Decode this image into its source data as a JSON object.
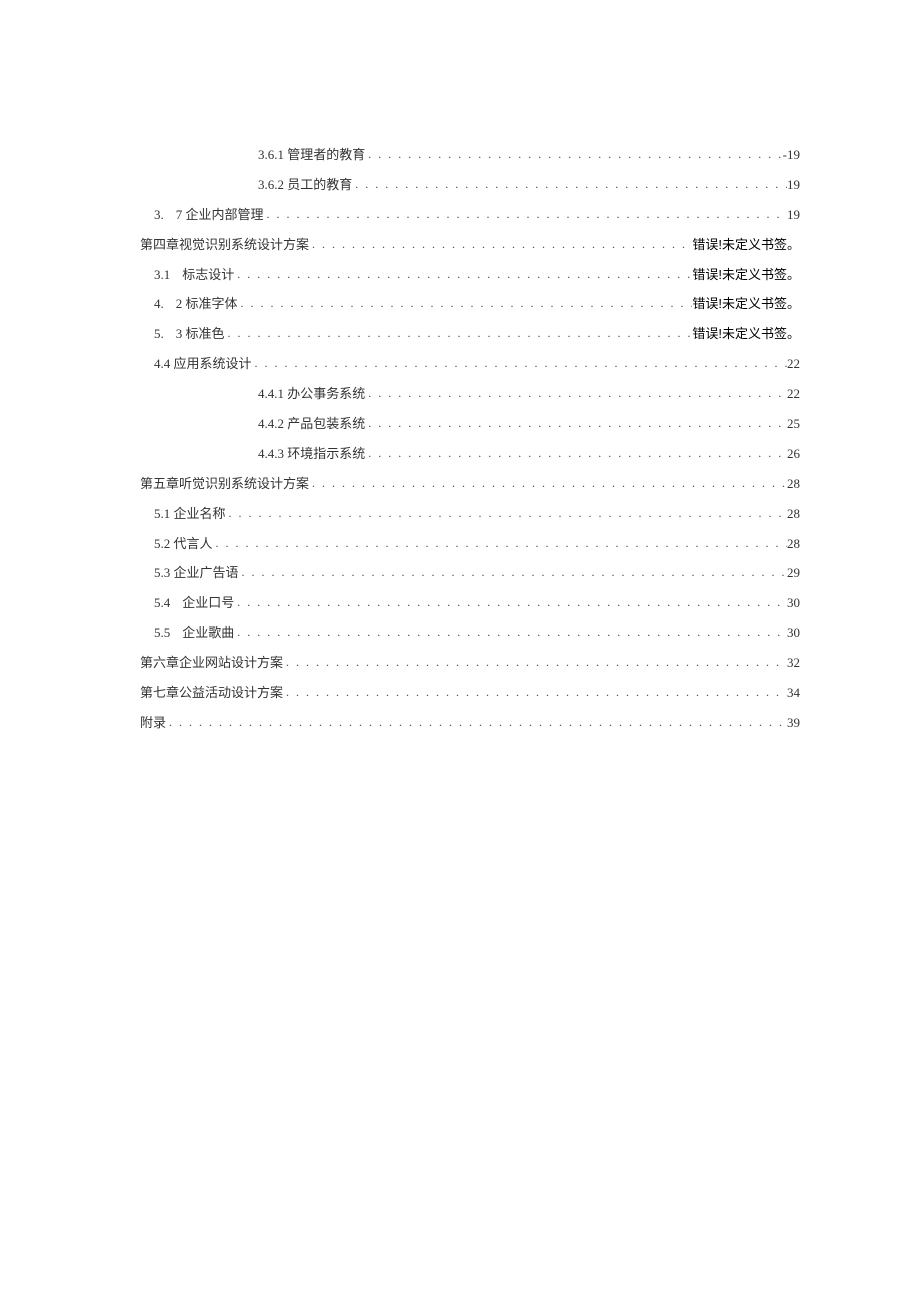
{
  "toc": [
    {
      "level": "level-3",
      "label": "3.6.1 管理者的教育",
      "page": "-19"
    },
    {
      "level": "level-3",
      "label": "3.6.2 员工的教育",
      "page": "19"
    },
    {
      "level": "level-2",
      "num": "3.",
      "label": "7 企业内部管理",
      "page": "19"
    },
    {
      "level": "level-1",
      "label": "第四章视觉识别系统设计方案",
      "page": "错误!未定义书签。",
      "err": true
    },
    {
      "level": "level-2",
      "num": "3.1",
      "label": "标志设计",
      "page": "错误!未定义书签。",
      "err": true
    },
    {
      "level": "level-2",
      "num": "4.",
      "label": "2 标准字体",
      "page": "错误!未定义书签。",
      "err": true
    },
    {
      "level": "level-2",
      "num": "5.",
      "label": "3 标准色",
      "page": "错误!未定义书签。",
      "err": true
    },
    {
      "level": "level-2b",
      "label": "4.4 应用系统设计",
      "page": "22"
    },
    {
      "level": "level-3",
      "label": "4.4.1 办公事务系统",
      "page": "22"
    },
    {
      "level": "level-3",
      "label": "4.4.2 产品包装系统",
      "page": "25"
    },
    {
      "level": "level-3",
      "label": "4.4.3 环境指示系统",
      "page": "26"
    },
    {
      "level": "level-1",
      "label": "第五章听觉识别系统设计方案",
      "page": "28"
    },
    {
      "level": "level-2b",
      "label": "5.1 企业名称",
      "page": "28"
    },
    {
      "level": "level-2b",
      "label": "5.2 代言人",
      "page": "28"
    },
    {
      "level": "level-2b",
      "label": "5.3 企业广告语",
      "page": "29"
    },
    {
      "level": "level-2",
      "num": "5.4",
      "label": "企业口号",
      "page": "30"
    },
    {
      "level": "level-2",
      "num": "5.5",
      "label": "企业歌曲",
      "page": "30"
    },
    {
      "level": "level-1",
      "label": "第六章企业网站设计方案",
      "page": "32"
    },
    {
      "level": "level-1",
      "label": "第七章公益活动设计方案",
      "page": "34"
    },
    {
      "level": "level-1",
      "label": "附录",
      "page": "39"
    }
  ]
}
